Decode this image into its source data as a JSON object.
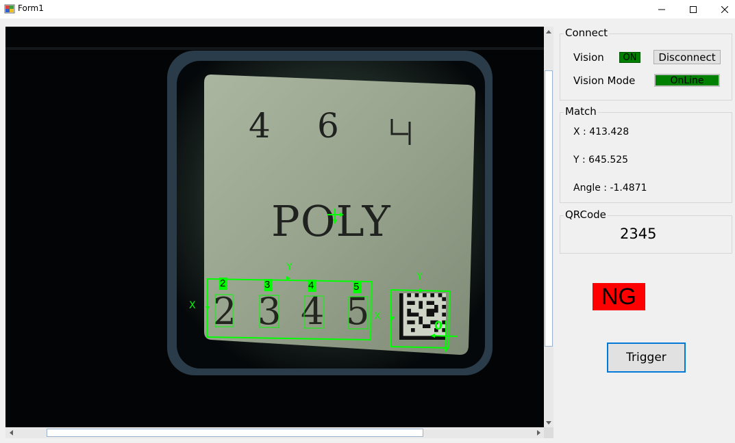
{
  "window": {
    "title": "Form1"
  },
  "image": {
    "label_top": [
      "4",
      "6",
      "ㅂ"
    ],
    "label_mid": "POLY",
    "digits": [
      "2",
      "3",
      "4",
      "5"
    ],
    "ocr_results": [
      "2",
      "3",
      "4",
      "5"
    ],
    "axis_x": "X",
    "axis_y": "Y",
    "qr_index": "0",
    "overlay_color": "#00ff00"
  },
  "connect": {
    "legend": "Connect",
    "vision_label": "Vision",
    "vision_status": "ON",
    "disconnect_label": "Disconnect",
    "mode_label": "Vision Mode",
    "mode_value": "OnLine"
  },
  "match": {
    "legend": "Match",
    "x": "X : 413.428",
    "y": "Y : 645.525",
    "angle": "Angle : -1.4871"
  },
  "qrcode": {
    "legend": "QRCode",
    "value": "2345"
  },
  "result": {
    "text": "NG",
    "color": "#ff0000"
  },
  "trigger_label": "Trigger"
}
